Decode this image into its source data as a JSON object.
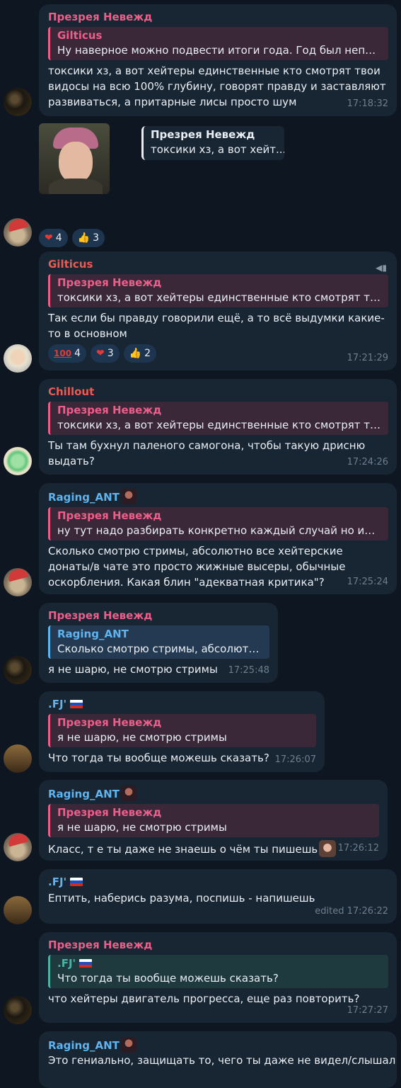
{
  "messages": [
    {
      "sender": "Презрея Невежд",
      "reply_name": "Gilticus",
      "reply_text": "Ну наверное можно подвести итоги года. Год был непло...",
      "text": "токсики хз, а вот хейтеры единственные кто смотрят твои видосы на всю 100% глубину, говорят правду и заставляют развиваться, а притарные лисы просто шум",
      "time": "17:18:32"
    },
    {
      "sticker_reply_name": "Презрея Невежд",
      "sticker_reply_text": "токсики хз, а вот хейт...",
      "reactions": [
        {
          "icon": "heart",
          "count": "4"
        },
        {
          "icon": "thumbs-up",
          "count": "3"
        }
      ]
    },
    {
      "sender": "Gilticus",
      "reply_name": "Презрея Невежд",
      "reply_text": "токсики хз, а вот хейтеры единственные кто смотрят тво...",
      "text": "Так если бы правду говорили ещё, а то всё выдумки какие-то в основном",
      "reactions": [
        {
          "icon": "100",
          "count": "4"
        },
        {
          "icon": "heart",
          "count": "3"
        },
        {
          "icon": "thumbs-up",
          "count": "2"
        }
      ],
      "time": "17:21:29"
    },
    {
      "sender": "Chillout",
      "reply_name": "Презрея Невежд",
      "reply_text": "токсики хз, а вот хейтеры единственные кто смотрят тво...",
      "text": "Ты там бухнул паленого самогона, чтобы такую дрисню выдать?",
      "time": "17:24:26"
    },
    {
      "sender": "Raging_ANT",
      "reply_name": "Презрея Невежд",
      "reply_text": "ну тут надо разбирать конкретно каждый случай  но ино...",
      "text": "Сколько смотрю стримы, абсолютно все хейтерские донаты/в чате это просто жижные высеры, обычные оскорбления. Какая блин \"адекватная критика\"?",
      "time": "17:25:24"
    },
    {
      "sender": "Презрея Невежд",
      "reply_name": "Raging_ANT",
      "reply_text": "Сколько смотрю стримы, абсолютн...",
      "text": "я не шарю, не смотрю стримы",
      "time": "17:25:48"
    },
    {
      "sender": ".FJ'",
      "reply_name": "Презрея Невежд",
      "reply_text": "я не шарю, не смотрю стримы",
      "text": "Что тогда ты вообще можешь сказать?",
      "time": "17:26:07"
    },
    {
      "sender": "Raging_ANT",
      "reply_name": "Презрея Невежд",
      "reply_text": "я не шарю, не смотрю стримы",
      "text": "Класс, т е ты даже не знаешь о чём ты пишешь",
      "time": "17:26:12"
    },
    {
      "sender": ".FJ'",
      "text": "Ептить, наберись разума, поспишь - напишешь",
      "time": "edited 17:26:22"
    },
    {
      "sender": "Презрея Невежд",
      "reply_name": ".FJ'",
      "reply_text": "Что тогда ты вообще можешь сказать?",
      "text": "что хейтеры двигатель прогресса, еще раз повторить?",
      "time": "17:27:27"
    },
    {
      "sender": "Raging_ANT",
      "text": "Это гениально, защищать то, чего ты даже не видел/слышал"
    }
  ],
  "colors": {
    "bg": "#0e1621",
    "bubble": "#182533",
    "pink": "#ee5e8a",
    "blue": "#5fb4ef",
    "red": "#ea5b52",
    "teal": "#4fb2a5",
    "white": "#e9eef4"
  }
}
